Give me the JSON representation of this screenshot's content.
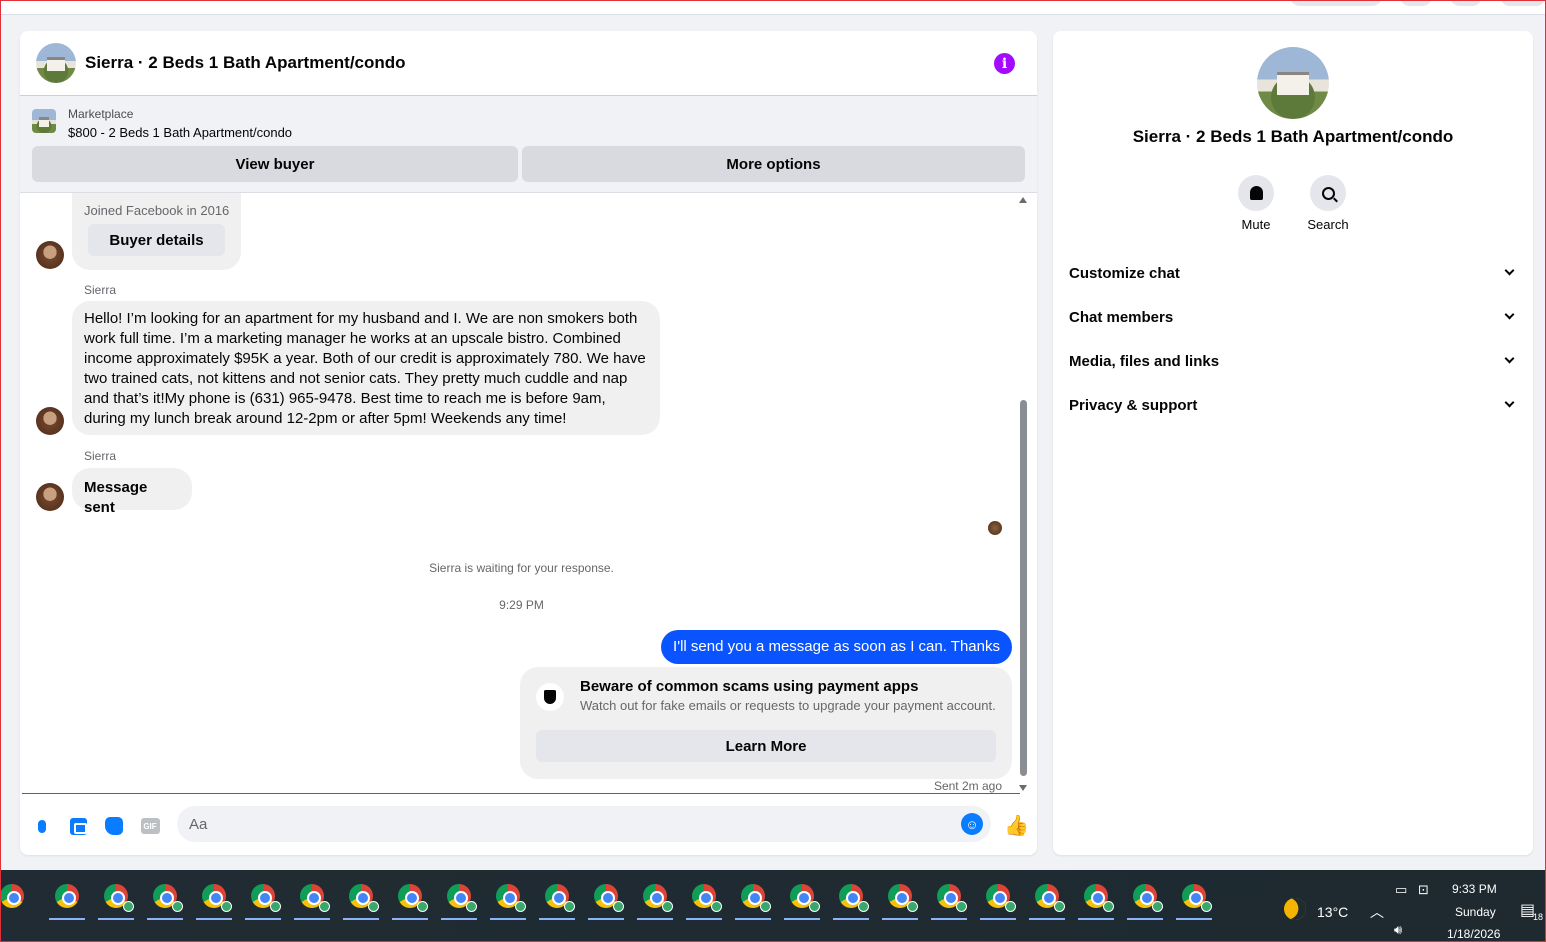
{
  "chat": {
    "title": "Sierra · 2 Beds 1 Bath Apartment/condo",
    "marketplace_label": "Marketplace",
    "listing": "$800 - 2 Beds 1 Bath Apartment/condo",
    "view_buyer": "View buyer",
    "more_options": "More options"
  },
  "thread": {
    "joined": "Joined Facebook in 2016",
    "buyer_details": "Buyer details",
    "sender1": "Sierra",
    "message1": "Hello! I’m looking for an apartment for my husband and I. We are non smokers both work full time. I’m a marketing manager he works at an upscale bistro. Combined income approximately $95K a year. Both of our credit is approximately 780. We have two trained cats, not kittens and not senior cats. They pretty much cuddle and nap and that’s it!My phone is (631) 965-9478. Best time to reach me is before 9am, during my lunch break around 12-2pm or after 5pm! Weekends any time!",
    "sender2": "Sierra",
    "message2": "Message sent",
    "waiting": "Sierra is waiting for your response.",
    "timestamp": "9:29 PM",
    "my_message": "I'll send you a message as soon as I can. Thanks",
    "scam_title": "Beware of common scams using payment apps",
    "scam_sub": "Watch out for fake emails or requests to upgrade your payment account.",
    "learn_more": "Learn More",
    "sent_status": "Sent 2m ago"
  },
  "composer": {
    "placeholder": "Aa",
    "gif_label": "GIF"
  },
  "side": {
    "title": "Sierra · 2 Beds 1 Bath Apartment/condo",
    "mute": "Mute",
    "search": "Search",
    "sections": [
      "Customize chat",
      "Chat members",
      "Media, files and links",
      "Privacy & support"
    ]
  },
  "taskbar": {
    "temperature": "13°C",
    "time": "9:33 PM",
    "day": "Sunday",
    "date": "1/18/2026",
    "notification_count": "18"
  },
  "colors": {
    "accent": "#0a54ff",
    "info": "#a20bff"
  }
}
